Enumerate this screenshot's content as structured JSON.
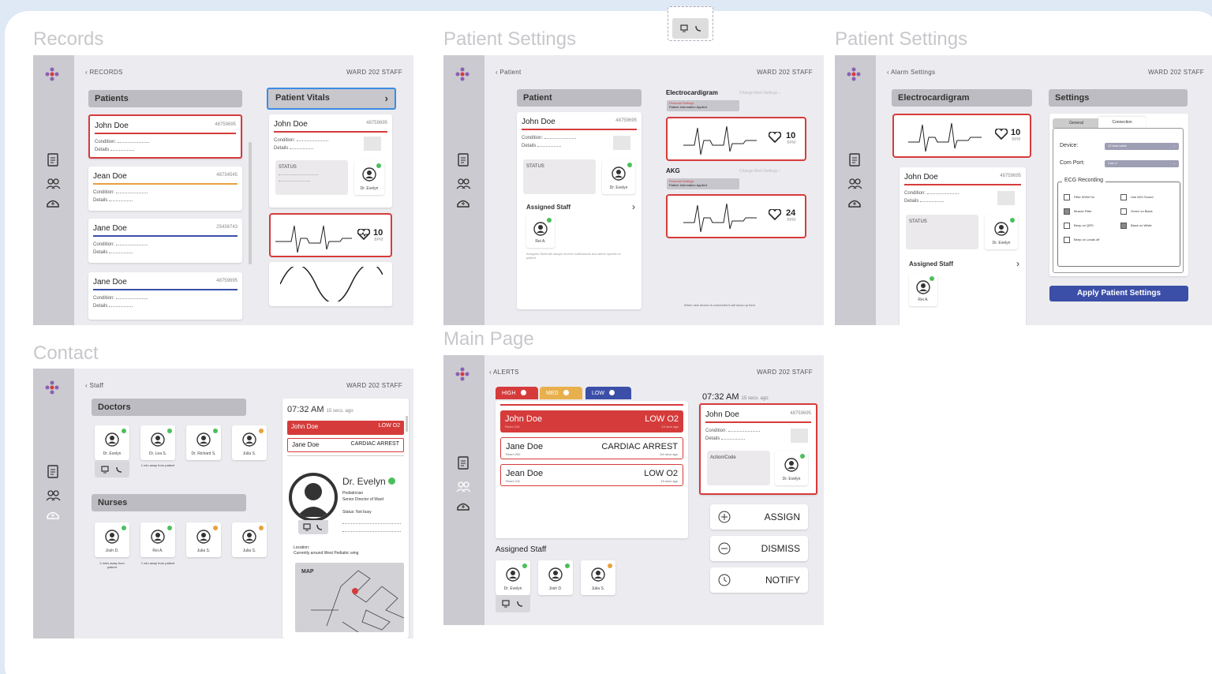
{
  "sections": {
    "records": "Records",
    "patient_settings_1": "Patient Settings",
    "patient_settings_2": "Patient Settings",
    "contact": "Contact",
    "main_page": "Main Page"
  },
  "common": {
    "ward": "WARD 202 STAFF",
    "icons": [
      "logo-icon",
      "clipboard-icon",
      "people-icon",
      "nurse-icon"
    ]
  },
  "records": {
    "back": "RECORDS",
    "patients_header": "Patients",
    "vitals_header": "Patient Vitals",
    "patients": [
      {
        "name": "John Doe",
        "id": "48759695",
        "line_color": "#d63b3b",
        "selected": true
      },
      {
        "name": "Jean Doe",
        "id": "48734545",
        "line_color": "#e8a23c",
        "selected": false
      },
      {
        "name": "Jane Doe",
        "id": "25436743",
        "line_color": "#3b4fa8",
        "selected": false
      },
      {
        "name": "Jane Doe",
        "id": "48759695",
        "line_color": "#3b4fa8",
        "selected": false
      }
    ],
    "condition_label": "Condition:",
    "details_label": "Details",
    "detail_card": {
      "name": "John Doe",
      "id": "48759695",
      "status": "STATUS",
      "staff": "Dr. Evelyn"
    },
    "ecg_bpm": "10",
    "bpm_unit": "BPM"
  },
  "patient_settings_1": {
    "back": "Patient",
    "patient_header": "Patient",
    "card": {
      "name": "John Doe",
      "id": "48759695",
      "status": "STATUS",
      "staff": "Dr. Evelyn"
    },
    "assigned_staff": "Assigned Staff",
    "staff_member": "Rei A.",
    "staff_note": "Assigned Staff will always receive notifications and alerts specific to patient",
    "ecg_label": "Electrocardigram",
    "ecg_link": "Change Alert Settings",
    "ecg_chip_1": "Personal Settings",
    "ecg_chip_2": "Patient Information Applied",
    "ecg_bpm": "10",
    "akg_label": "AKG",
    "akg_link": "Change Alert Settings",
    "akg_chip_1": "Personal Settings",
    "akg_chip_2": "Patient Information Applied",
    "akg_bpm": "24",
    "bpm_unit": "BPM",
    "footer_note": "When new device is connected it will show up here",
    "hover_icons": [
      "monitor-icon",
      "phone-icon"
    ]
  },
  "patient_settings_2": {
    "back": "Alarm Settings",
    "ecg_header": "Electrocardigram",
    "settings_header": "Settings",
    "tabs": [
      "General",
      "Connection"
    ],
    "device_label": "Device:",
    "device_value": "12 lead cable",
    "com_label": "Com Port:",
    "com_value": "Com 4",
    "ecg_recording": "ECG Recording",
    "checks": [
      {
        "label": "Filter 50/60 Hz",
        "on": false
      },
      {
        "label": "Use MGI Sound",
        "on": false
      },
      {
        "label": "Muscle Filter",
        "on": true
      },
      {
        "label": "Green on Black",
        "on": false
      },
      {
        "label": "Beep on QRS",
        "on": false
      },
      {
        "label": "Black on White",
        "on": true
      },
      {
        "label": "Beep on Leads off",
        "on": false
      }
    ],
    "apply": "Apply Patient Settings",
    "card": {
      "name": "John Doe",
      "id": "48759695",
      "status": "STATUS",
      "staff": "Dr. Evelyn"
    },
    "assigned_staff": "Assigned Staff",
    "staff_member": "Rei A.",
    "ecg_bpm": "10",
    "bpm_unit": "BPM"
  },
  "contact": {
    "back": "Staff",
    "doctors_header": "Doctors",
    "nurses_header": "Nurses",
    "doctors": [
      {
        "name": "Dr. Evelyn",
        "status": "#4bbf5c",
        "note": ""
      },
      {
        "name": "Dr. Lea S.",
        "status": "#4bbf5c",
        "note": "1 min away from patient"
      },
      {
        "name": "Dr. Richard S.",
        "status": "#4bbf5c",
        "note": ""
      },
      {
        "name": "Julia S.",
        "status": "#e8a23c",
        "note": ""
      }
    ],
    "nurses": [
      {
        "name": "Josh D.",
        "status": "#4bbf5c",
        "note": "2 mins away from patient"
      },
      {
        "name": "Rei A.",
        "status": "#4bbf5c",
        "note": "1 min away from patient"
      },
      {
        "name": "Julia S.",
        "status": "#e8a23c",
        "note": ""
      },
      {
        "name": "Julia S.",
        "status": "#e8a23c",
        "note": ""
      }
    ],
    "time": "07:32 AM",
    "time_ago": "15 secs. ago",
    "alerts": [
      {
        "name": "John Doe",
        "type": "LOW O2",
        "style": "red"
      },
      {
        "name": "Jane Doe",
        "type": "CARDIAC ARREST",
        "style": "outline"
      }
    ],
    "profile_name": "Dr. Evelyn",
    "profile_role": "Pediatrician",
    "profile_title": "Senior Director of Ward",
    "profile_status": "Status: Not busy",
    "location_label": "Location:",
    "location_text": "Currently around West Pediatric wing",
    "map_label": "MAP"
  },
  "main": {
    "back": "ALERTS",
    "tabs": [
      {
        "label": "HIGH",
        "color": "#d63b3b"
      },
      {
        "label": "MED",
        "color": "#e8b04c"
      },
      {
        "label": "LOW",
        "color": "#3b4fa8"
      }
    ],
    "alerts": [
      {
        "name": "John Doe",
        "room": "Room 216",
        "type": "LOW O2",
        "ago": "15 secs ago",
        "style": "red"
      },
      {
        "name": "Jane Doe",
        "room": "Room 202",
        "type": "CARDIAC ARREST",
        "ago": "2m secs ago",
        "style": "outline"
      },
      {
        "name": "Jean Doe",
        "room": "Room 211",
        "type": "LOW O2",
        "ago": "15 secs ago",
        "style": "outline"
      }
    ],
    "time": "07:32 AM",
    "time_ago": "15 secs. ago",
    "card": {
      "name": "John Doe",
      "id": "48759695",
      "action": "Action/Code",
      "staff": "Dr. Evelyn"
    },
    "assign": "ASSIGN",
    "dismiss": "DISMISS",
    "notify": "NOTIFY",
    "assigned_staff": "Assigned Staff",
    "staff": [
      {
        "name": "Dr. Evelyn",
        "status": "#4bbf5c"
      },
      {
        "name": "Josh D.",
        "status": "#4bbf5c"
      },
      {
        "name": "Julia S.",
        "status": "#e8a23c"
      }
    ]
  }
}
